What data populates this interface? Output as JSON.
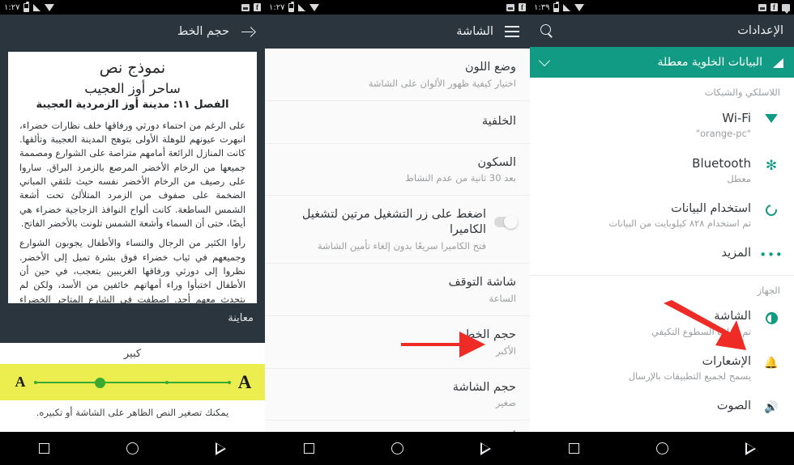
{
  "colors": {
    "appbar_dark": "#2b353e",
    "accent_green": "#129b84",
    "icon_green": "#0f9b82",
    "slider_band": "#ebee4e",
    "slider_green": "#3aab2e",
    "arrow_red": "#ee2b24"
  },
  "panel1": {
    "statusbar": {
      "time": "١:٢٧",
      "icons_left": [
        "battery-icon",
        "signal-icon",
        "wifi-icon"
      ],
      "icons_right": [
        "screenshot-icon",
        "facebook-icon"
      ]
    },
    "appbar": {
      "title": "حجم الخط",
      "back_icon": "arrow-right-icon"
    },
    "preview": {
      "label": "معاينة",
      "heading1": "نموذج نص",
      "heading2": "ساحر أوز العجيب",
      "heading3": "الفصل ١١: مدينة أوز الزمردية العجيبة",
      "paragraph1": "على الرغم من احتماء دورثي ورفاقها خلف نظارات خضراء، انبهرت عيونهم للوهلة الأولى بتوهج المدينة العجيبة وتألقها. كانت المنازل الرائعة أمامهم متراصة على الشوارع ومصممة جميعها من الرخام الأخضر المرصع بالزمرد البراق. ساروا على رصيف من الرخام الأخضر نفسه حيث تلتقي المباني الضخمة على صفوف من الزمرد المتلألئ تحت أشعة الشمس الساطعة. كانت ألواح النوافذ الزجاجية خضراء هي أيضًا، حتى أن السماء وأشعة الشمس تلونت بالأخضر الفاتح.",
      "paragraph2": "رأوا الكثير من الرجال والنساء والأطفال يجوبون الشوارع وجميعهم في ثياب خضراء فوق بشرة تميل إلى الأخضر. نظروا إلى دورثي ورفاقها الغريبين بتعجب، في حين أن الأطفال اختبأوا وراء أمهاتهم خائفين من الأسد، ولكن لم يتحدث معهم أحد. اصطفت في الشارع المتاجر الخضراء ولاحظت دورثي أن كل ما فيها كان أخضر، من الحلوى الخضراء والفشار الأخضر إلى الأحذية والقبعات والملابس الخضراء. وفي أحد الأركان، وقف رجل يبيع الليموناضة الخضراء"
    },
    "size_control": {
      "current_label": "كبير",
      "small_letter": "A",
      "large_letter": "A",
      "ticks": 4,
      "selected_index": 1,
      "hint": "يمكنك تصغير النص الظاهر على الشاشة أو تكبيره."
    },
    "navbar": [
      "recents-icon",
      "home-icon",
      "back-icon"
    ]
  },
  "panel2": {
    "statusbar": {
      "time": "١:٢٧",
      "icons_left": [
        "battery-icon",
        "signal-icon",
        "wifi-icon"
      ],
      "icons_right": [
        "screenshot-icon",
        "facebook-icon"
      ]
    },
    "appbar": {
      "title": "الشاشة",
      "menu_icon": "hamburger-icon"
    },
    "rows": [
      {
        "title": "وضع اللون",
        "sub": "اختيار كيفية ظهور الألوان على الشاشة",
        "toggle": null
      },
      {
        "title": "الخلفية",
        "sub": "",
        "toggle": null
      },
      {
        "title": "السكون",
        "sub": "بعد 30 ثانية من عدم النشاط",
        "toggle": null
      },
      {
        "title": "اضغط على زر التشغيل مرتين لتشغيل الكاميرا",
        "sub": "فتح الكاميرا سريعًا بدون إلغاء تأمين الشاشة",
        "toggle": "off"
      },
      {
        "title": "شاشة التوقف",
        "sub": "الساعة",
        "toggle": null
      },
      {
        "title": "حجم الخط",
        "sub": "الأكبر",
        "toggle": null
      },
      {
        "title": "حجم الشاشة",
        "sub": "صغير",
        "toggle": null
      },
      {
        "title": "أوقات تدوير الجهاز",
        "sub": "",
        "toggle": null
      }
    ],
    "highlight_row_index": 5,
    "navbar": [
      "recents-icon",
      "home-icon",
      "back-icon"
    ]
  },
  "panel3": {
    "statusbar": {
      "time": "١:٣٩",
      "icons_left": [
        "battery-icon",
        "signal-icon",
        "wifi-icon"
      ],
      "icons_right": [
        "screenshot-icon",
        "facebook-icon",
        "message-icon"
      ]
    },
    "appbar": {
      "title": "الإعدادات",
      "search_icon": "search-icon"
    },
    "banner": {
      "text": "البيانات الخلوية معطلة",
      "left_icon": "cellular-off-icon",
      "right_icon": "chevron-down-icon"
    },
    "section1_title": "اللاسلكي والشبكات",
    "section1_rows": [
      {
        "icon": "wifi-icon",
        "title": "Wi-Fi",
        "sub": "\"orange-pc\"",
        "ltr": true
      },
      {
        "icon": "bluetooth-icon",
        "title": "Bluetooth",
        "sub": "معطل",
        "ltr": true
      },
      {
        "icon": "data-usage-icon",
        "title": "استخدام البيانات",
        "sub": "تم استخدام ٨٢٨ كيلوبايت من البيانات",
        "ltr": false
      },
      {
        "icon": "more-icon",
        "title": "المزيد",
        "sub": "",
        "ltr": false
      }
    ],
    "section2_title": "الجهاز",
    "section2_rows": [
      {
        "icon": "brightness-icon",
        "title": "الشاشة",
        "sub": "تم إيقاف السطوع التكيفي",
        "ltr": false
      },
      {
        "icon": "bell-icon",
        "title": "الإشعارات",
        "sub": "يسمح لجميع التطبيقات بالإرسال",
        "ltr": false
      },
      {
        "icon": "sound-icon",
        "title": "الصوت",
        "sub": "",
        "ltr": false
      }
    ],
    "highlight_row": "الشاشة",
    "navbar": [
      "recents-icon",
      "home-icon",
      "back-icon"
    ]
  }
}
